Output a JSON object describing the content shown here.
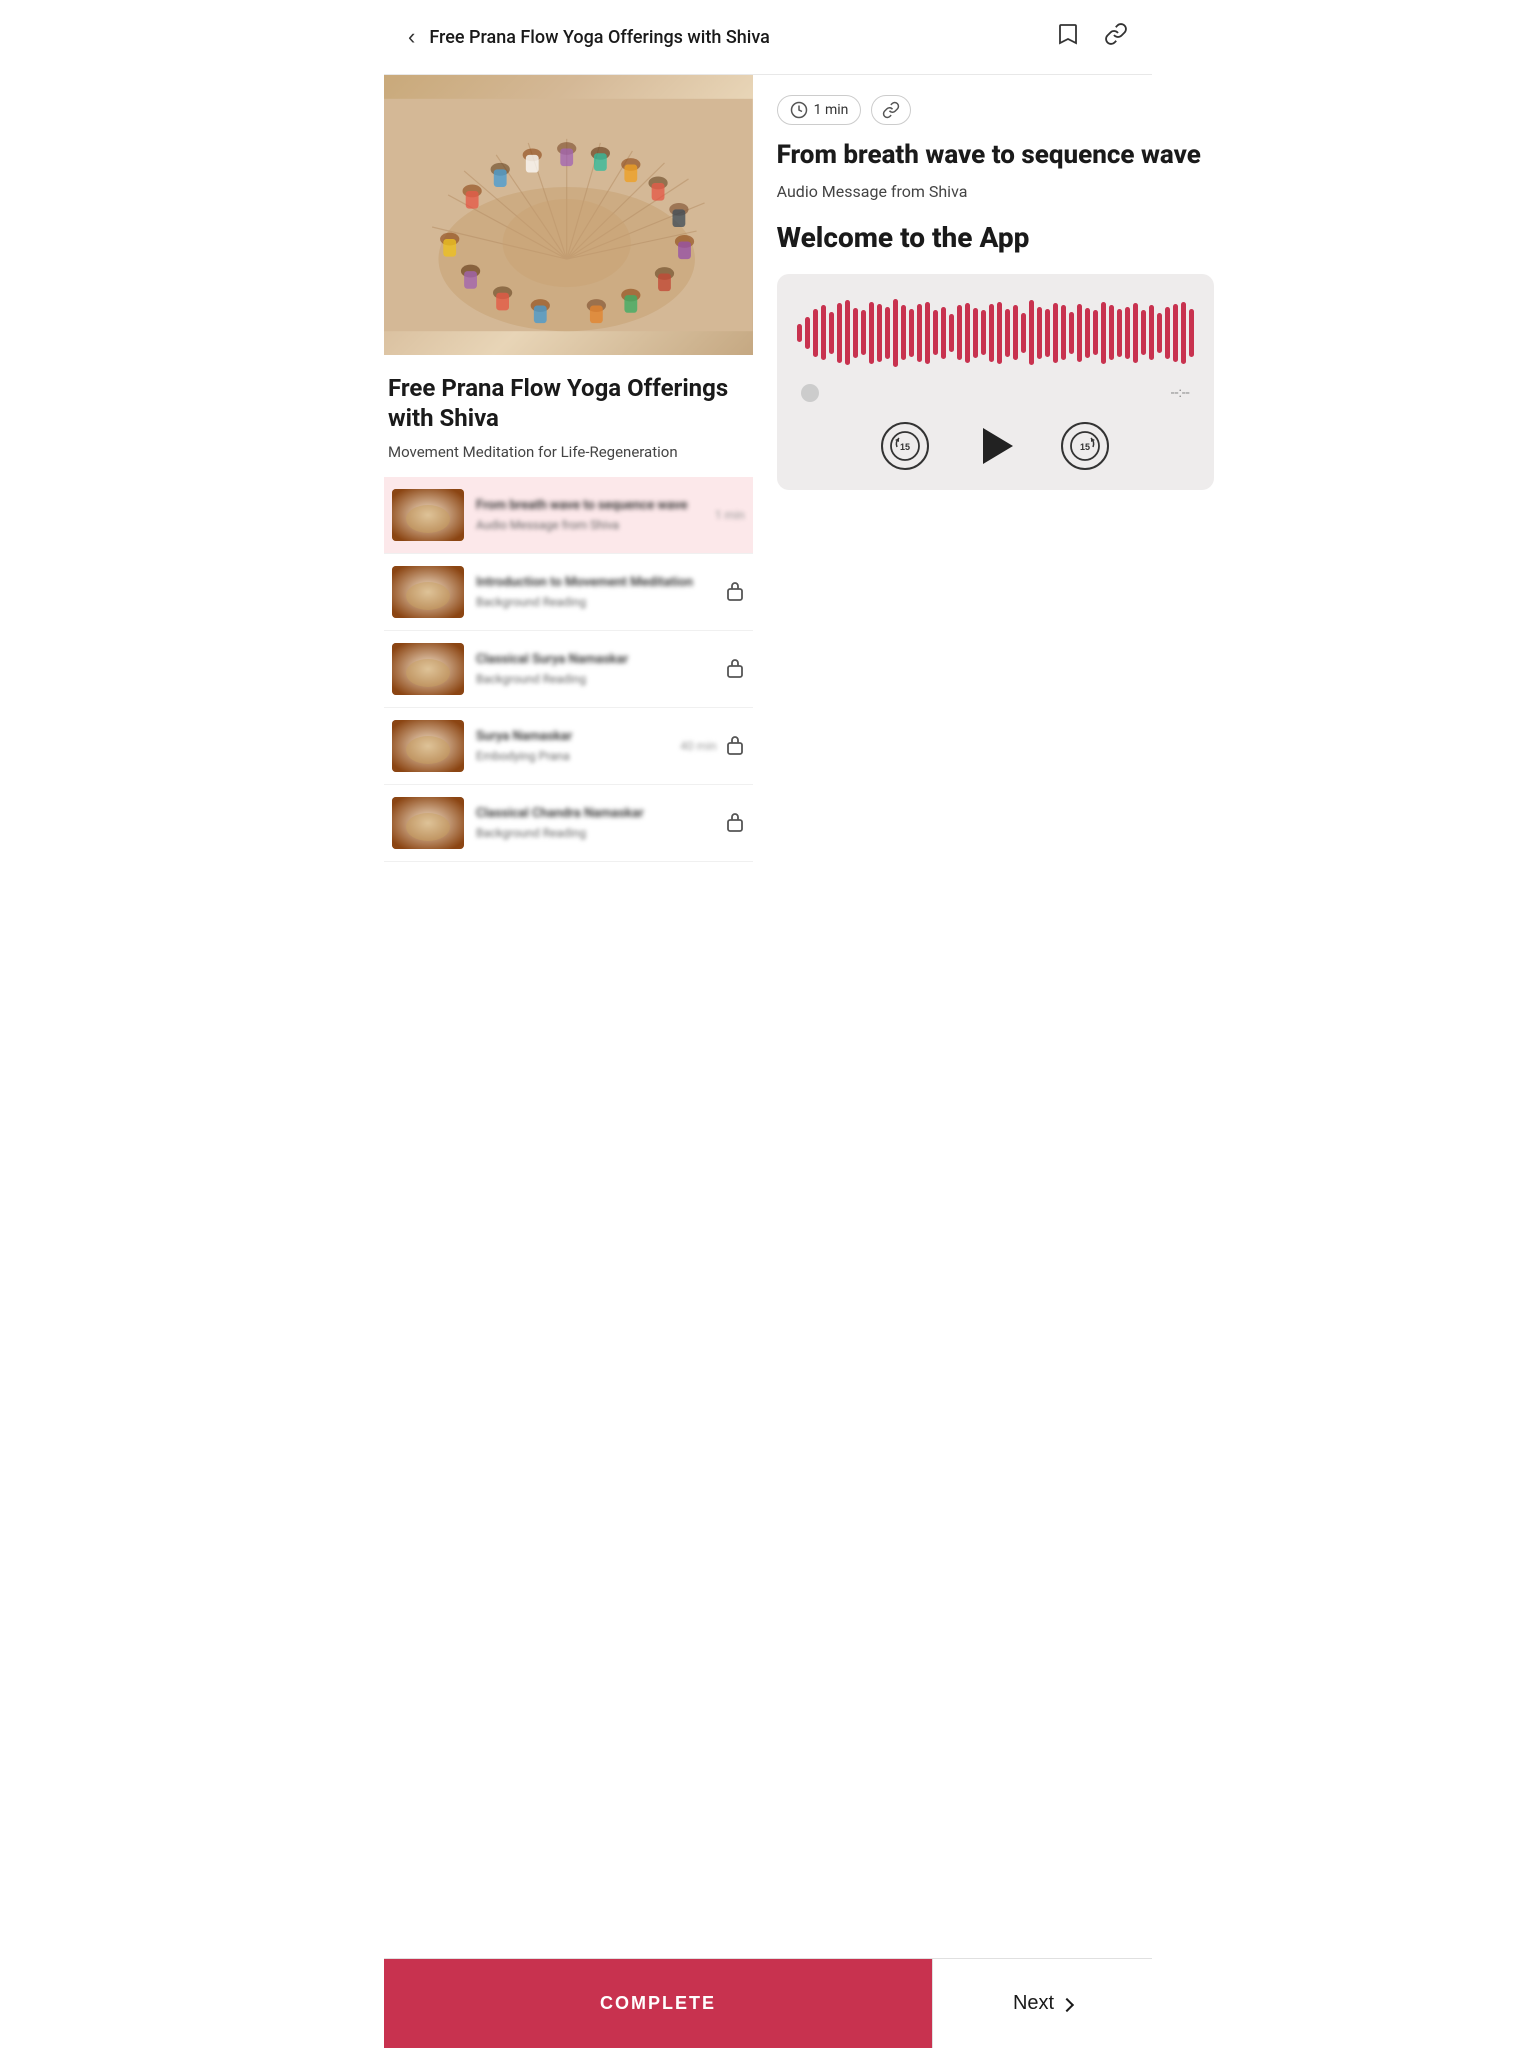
{
  "header": {
    "back_label": "←",
    "title": "Free Prana Flow Yoga Offerings with Shiva",
    "bookmark_icon": "bookmark",
    "link_icon": "link"
  },
  "lesson": {
    "duration": "1 min",
    "title": "From breath wave to sequence wave",
    "audio_label": "Audio Message from Shiva",
    "welcome_title": "Welcome to the App",
    "progress_time": "--:--"
  },
  "course": {
    "title": "Free Prana Flow Yoga Offerings with Shiva",
    "subtitle": "Movement Meditation for Life-Regeneration"
  },
  "lessons": [
    {
      "name": "From breath wave to sequence wave",
      "type": "Audio Message from Shiva",
      "duration": "1 min",
      "locked": false,
      "active": true,
      "thumb_class": "thumb-1"
    },
    {
      "name": "Introduction to Movement Meditation",
      "type": "Background Reading",
      "duration": "",
      "locked": true,
      "active": false,
      "thumb_class": "thumb-2"
    },
    {
      "name": "Classical Surya Namaskar",
      "type": "Background Reading",
      "duration": "",
      "locked": true,
      "active": false,
      "thumb_class": "thumb-3"
    },
    {
      "name": "Surya Namaskar",
      "type": "Embodying Prana",
      "duration": "40 min",
      "locked": true,
      "active": false,
      "thumb_class": "thumb-4"
    },
    {
      "name": "Classical Chandra Namaskar",
      "type": "Background Reading",
      "duration": "",
      "locked": true,
      "active": false,
      "thumb_class": "thumb-5"
    }
  ],
  "waveform_bars": [
    18,
    32,
    48,
    55,
    42,
    60,
    65,
    50,
    45,
    62,
    58,
    52,
    68,
    55,
    48,
    58,
    62,
    45,
    52,
    38,
    55,
    60,
    50,
    45,
    58,
    62,
    48,
    55,
    40,
    65,
    52,
    48,
    60,
    55,
    42,
    58,
    50,
    45,
    62,
    55,
    48,
    52,
    60,
    45,
    55,
    40,
    52,
    58,
    62,
    48
  ],
  "bottom_bar": {
    "complete_label": "COMPLETE",
    "next_label": "Next"
  }
}
